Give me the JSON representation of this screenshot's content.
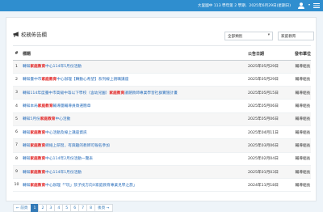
{
  "header": {
    "info": "大里國中 113 學年第 2 學期．2025年6月29日(星期日)",
    "colors": {
      "bar": "#2f8ecf",
      "text": "#ffffff"
    },
    "icons": {
      "user": "user-icon",
      "menu": "list-icon",
      "caret": "caret-down-icon"
    }
  },
  "panel": {
    "title": "校務佈告欄",
    "title_icon": "megaphone-icon",
    "filter": {
      "selected": "全部類別"
    },
    "search": {
      "value": "家庭教育"
    }
  },
  "table": {
    "headers": [
      "#",
      "標題",
      "公告日期",
      "發布單位"
    ],
    "rows": [
      {
        "num": "1",
        "pre": "轉知",
        "hl": "家庭教育",
        "post": "中心114年5月份活動",
        "date": "2025年05月29日",
        "unit": "輔導組長"
      },
      {
        "num": "2",
        "pre": "轉知臺中市",
        "hl": "家庭教育",
        "post": "中心辦理【轉動心希望】系列線上親職講座",
        "date": "2025年05月29日",
        "unit": "輔導組長"
      },
      {
        "num": "3",
        "pre": "轉知114年度臺中市高級中等以下學校（含幼兒園）",
        "hl": "家庭教育",
        "post": "議題教師專業學習社群實施計畫",
        "date": "2025年05月15日",
        "unit": "輔導組長"
      },
      {
        "num": "4",
        "pre": "轉知本局",
        "hl": "家庭教育",
        "post": "輔導團輔導員徵選簡章",
        "date": "2025年05月06日",
        "unit": "輔導組長"
      },
      {
        "num": "5",
        "pre": "轉知5月份",
        "hl": "家庭教育",
        "post": "中心活動",
        "date": "2025年05月06日",
        "unit": "輔導組長"
      },
      {
        "num": "6",
        "pre": "轉知",
        "hl": "家庭教育",
        "post": "中心活動及線上講座資訊",
        "date": "2025年04月11日",
        "unit": "輔導組長"
      },
      {
        "num": "7",
        "pre": "轉知",
        "hl": "家庭教育",
        "post": "網絡上研習，有興趣的教師可報名參加",
        "date": "2025年03月06日",
        "unit": "輔導組長"
      },
      {
        "num": "8",
        "pre": "轉知",
        "hl": "家庭教育",
        "post": "中心114年2月份活動一覽表",
        "date": "2025年02月04日",
        "unit": "輔導組長"
      },
      {
        "num": "9",
        "pre": "轉知",
        "hl": "家庭教育",
        "post": "中心114年1月份活動",
        "date": "2025年01月03日",
        "unit": "輔導組長"
      },
      {
        "num": "10",
        "pre": "轉知",
        "hl": "家庭教育",
        "post": "中心辦理「「玩」孩子找方向X家庭教育專業見學之旅」",
        "date": "2024年11月18日",
        "unit": "輔導組長"
      }
    ]
  },
  "pagination": {
    "prev": "← 前頁",
    "pages": [
      "1",
      "2",
      "3",
      "4",
      "5",
      "6",
      "7",
      "8"
    ],
    "current": "1",
    "next": "後頁 →"
  }
}
